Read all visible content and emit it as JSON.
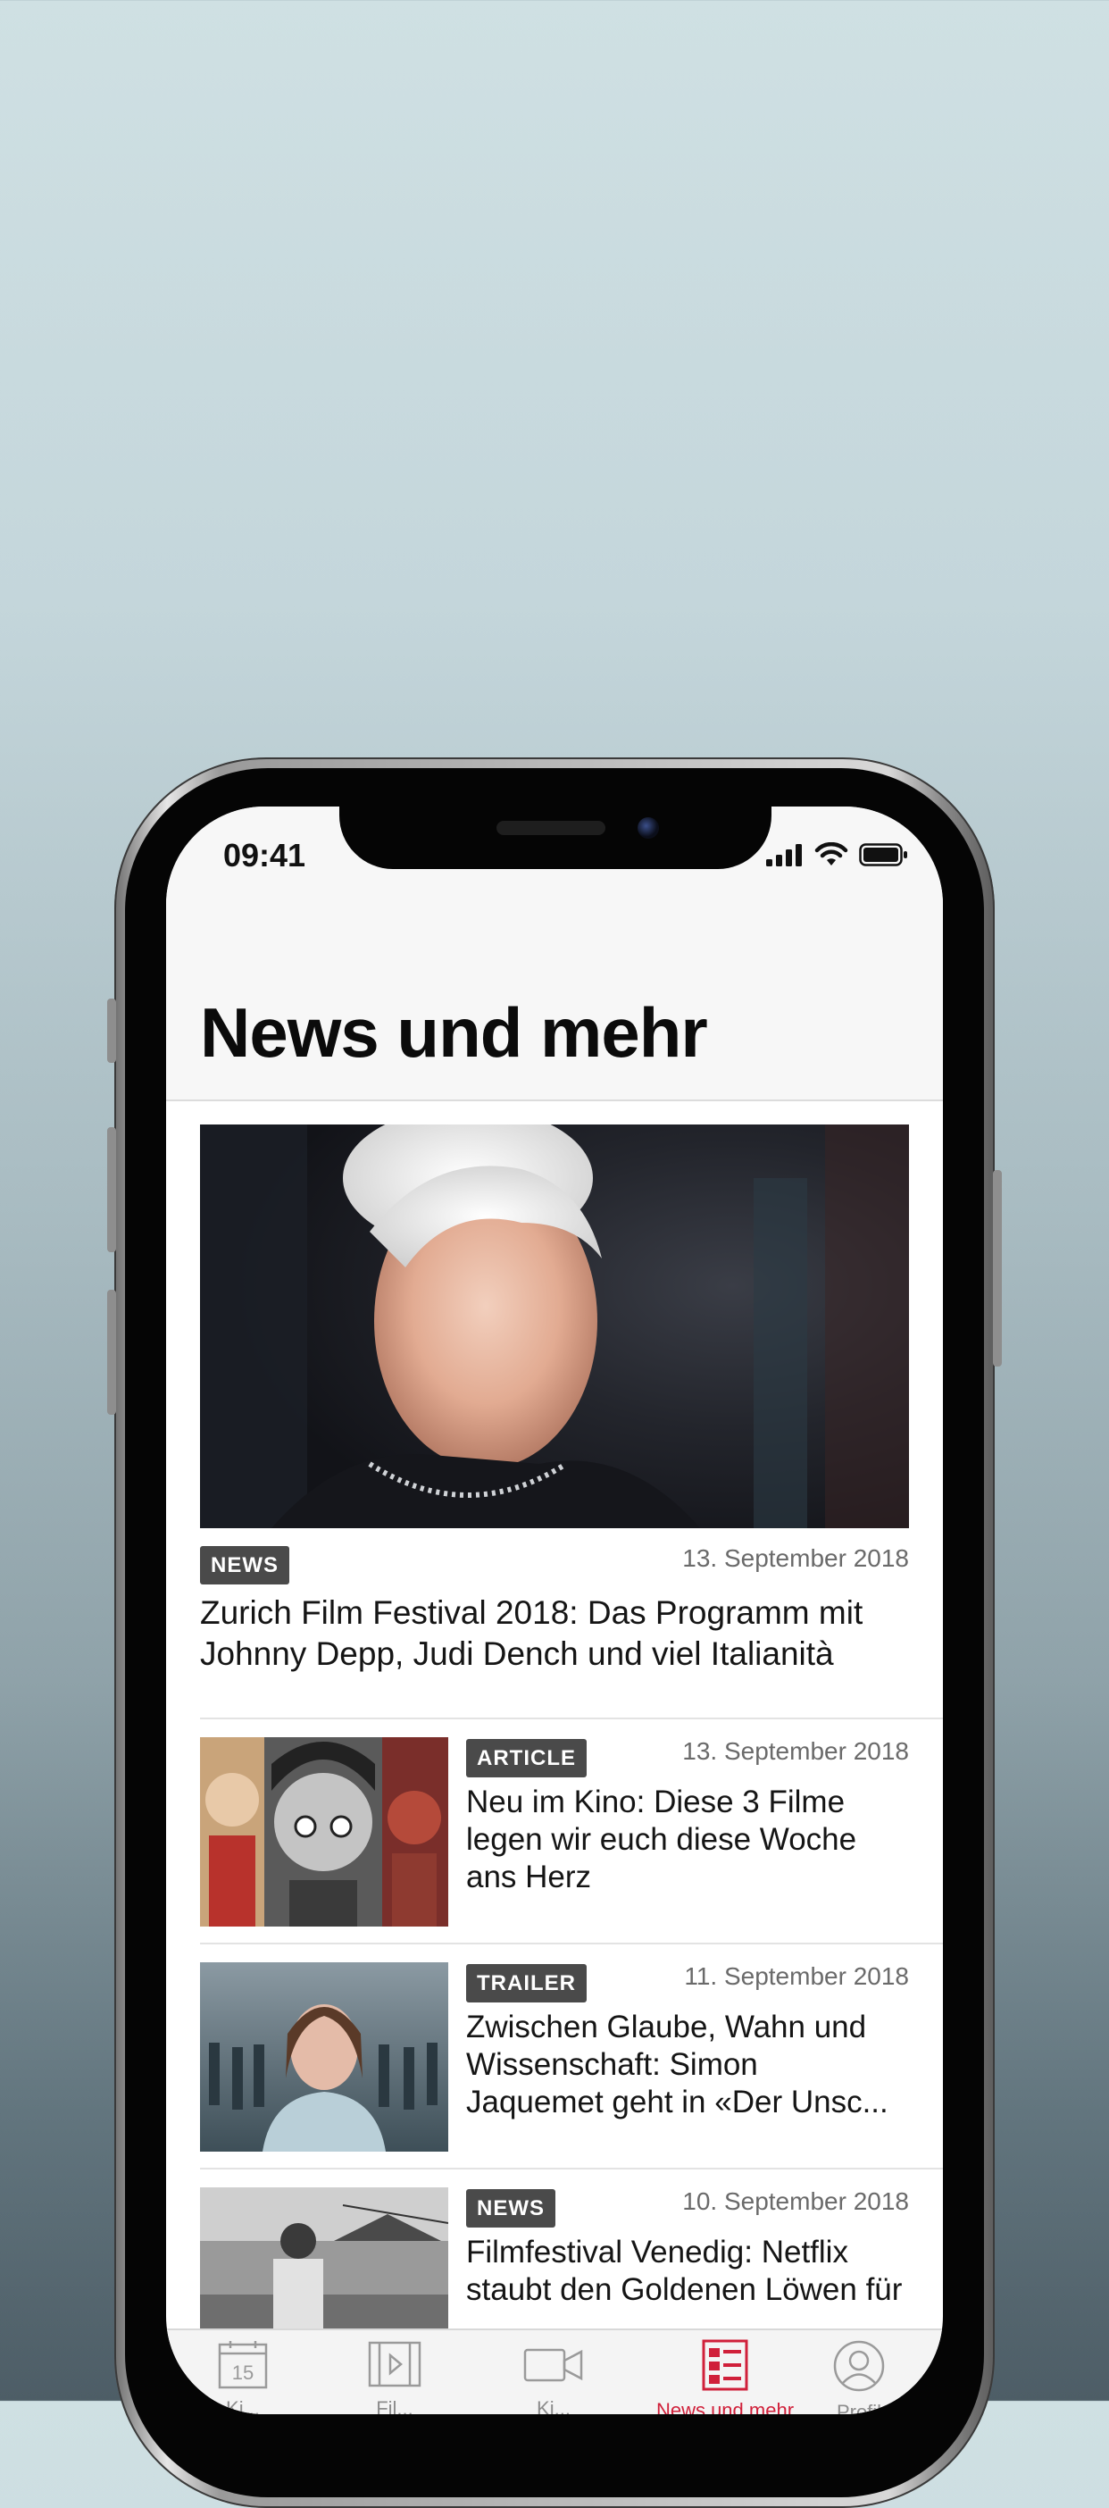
{
  "status_bar": {
    "time": "09:41"
  },
  "page": {
    "title": "News und mehr"
  },
  "articles": [
    {
      "badge": "NEWS",
      "date": "13. September 2018",
      "headline_line1": "Zurich Film Festival 2018: Das Programm mit",
      "headline_line2": "Johnny Depp, Judi Dench und viel Italianità"
    },
    {
      "badge": "ARTICLE",
      "date": "13. September 2018",
      "headline_line1": "Neu im Kino: Diese 3 Filme",
      "headline_line2": "legen wir euch diese Woche",
      "headline_line3": "ans Herz"
    },
    {
      "badge": "TRAILER",
      "date": "11. September 2018",
      "headline_line1": "Zwischen Glaube, Wahn und",
      "headline_line2": "Wissenschaft: Simon",
      "headline_line3": "Jaquemet geht in «Der Unsc..."
    },
    {
      "badge": "NEWS",
      "date": "10. September 2018",
      "headline_line1": "Filmfestival Venedig: Netflix",
      "headline_line2": "staubt den Goldenen Löwen für"
    }
  ],
  "tabbar": {
    "tabs": [
      {
        "label": "Ki...",
        "icon": "calendar-icon",
        "day": "15"
      },
      {
        "label": "Fil...",
        "icon": "film-strip-icon"
      },
      {
        "label": "Ki...",
        "icon": "video-camera-icon"
      },
      {
        "label": "News und mehr",
        "icon": "news-icon"
      },
      {
        "label": "Profil",
        "icon": "profile-icon"
      }
    ],
    "active_color": "#d0203a"
  }
}
